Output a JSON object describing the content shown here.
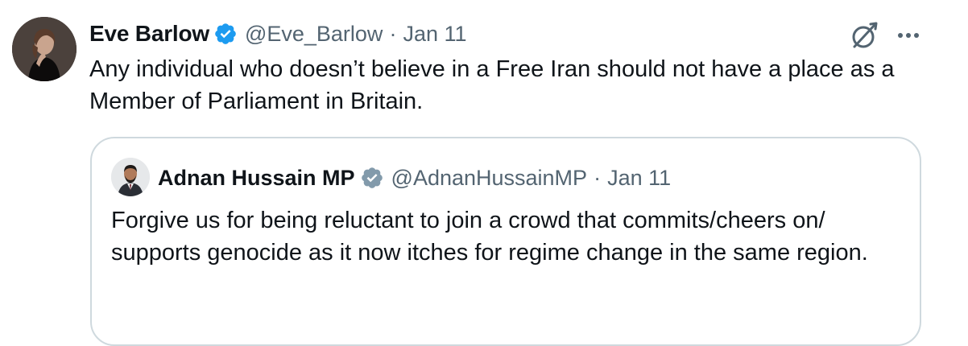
{
  "tweet": {
    "author_name": "Eve Barlow",
    "handle": "@Eve_Barlow",
    "separator": "·",
    "date": "Jan 11",
    "text": "Any individual who doesn’t believe in a Free Iran should not have a place as a Member of Parliament in Britain.",
    "verified_badge": "blue-check",
    "actions": [
      "grok-icon",
      "more-icon"
    ]
  },
  "quoted_tweet": {
    "author_name": "Adnan Hussain MP",
    "handle": "@AdnanHussainMP",
    "separator": "·",
    "date": "Jan 11",
    "text": "Forgive us for being reluctant to join a crowd that commits/cheers on/ supports genocide as it now itches for regime change in the same region.",
    "verified_badge": "grey-check"
  },
  "colors": {
    "primary_text": "#0f1419",
    "secondary_text": "#536471",
    "verified_blue": "#1d9bf0",
    "verified_grey": "#829aab",
    "card_border": "#cfd9de"
  }
}
